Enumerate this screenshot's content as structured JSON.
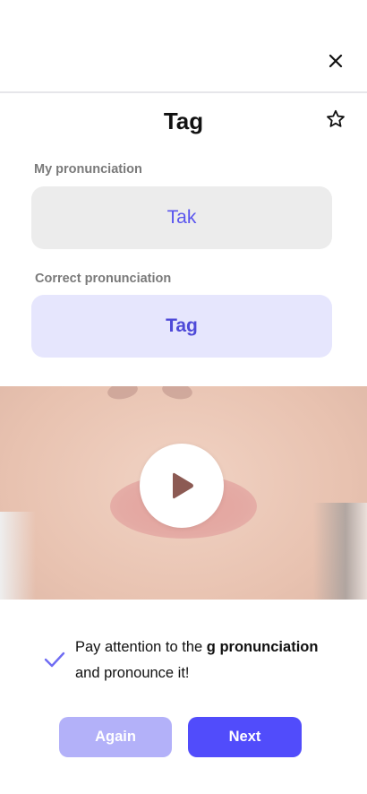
{
  "header": {
    "close_icon": "close-icon",
    "title": "Tag",
    "favorite_icon": "star-outline-icon"
  },
  "my_pronunciation": {
    "label": "My pronunciation",
    "value": "Tak"
  },
  "correct_pronunciation": {
    "label": "Correct pronunciation",
    "value": "Tag"
  },
  "video": {
    "play_icon": "play-icon"
  },
  "tip": {
    "icon": "check-icon",
    "text_before": "Pay attention to the ",
    "text_bold": "g pronunciation",
    "text_after": " and pronounce it!"
  },
  "actions": {
    "again_label": "Again",
    "next_label": "Next"
  },
  "colors": {
    "accent": "#514cfb",
    "accent_light": "#b3b1f9",
    "correct_bg": "#e6e6fd",
    "my_bg": "#ececec"
  }
}
